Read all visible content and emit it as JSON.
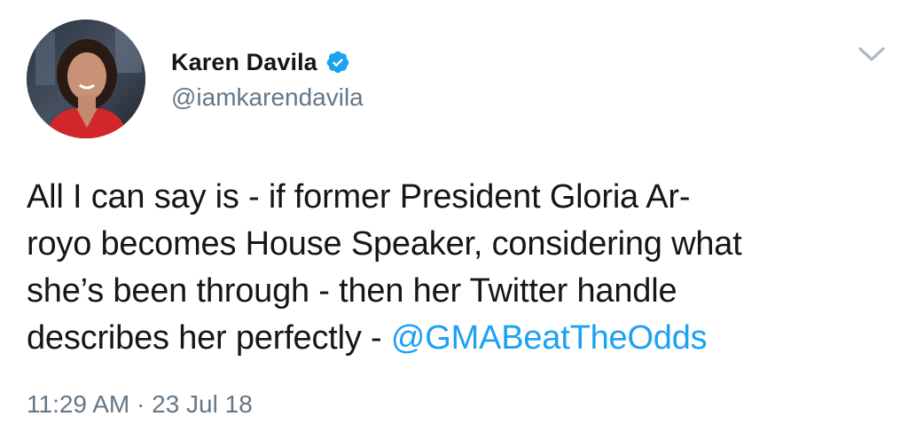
{
  "tweet": {
    "display_name": "Karen Davila",
    "handle": "@iamkarendavila",
    "verified": true,
    "text_lines": [
      "All I can say is - if former President Gloria Ar-",
      "royo becomes House Speaker, considering what",
      "she’s been through - then her Twitter handle",
      "describes her perfectly - "
    ],
    "mention": "@GMABeatTheOdds",
    "time": "11:29 AM",
    "separator": " · ",
    "date": "23 Jul 18"
  },
  "icons": {
    "verified": "verified-badge-icon",
    "menu": "chevron-down-icon"
  },
  "colors": {
    "link": "#1da1f2",
    "text": "#14171a",
    "secondary": "#657786",
    "verified": "#1da1f2",
    "caret": "#aab8c2"
  }
}
